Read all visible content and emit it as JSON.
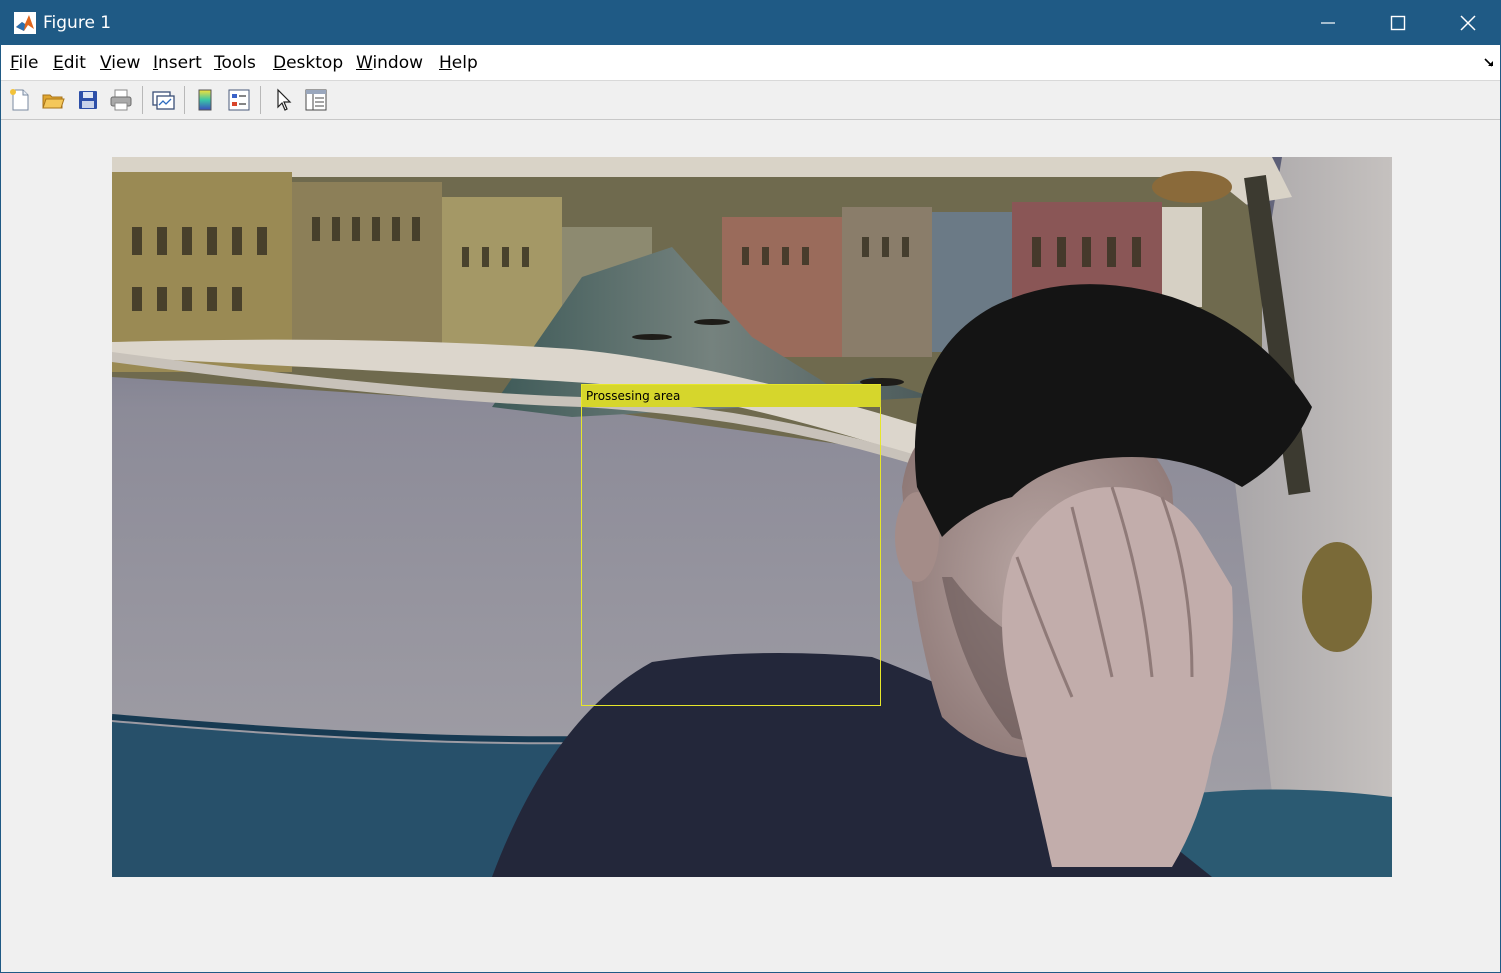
{
  "window": {
    "title": "Figure 1",
    "controls": {
      "minimize_icon": "minimize-icon",
      "maximize_icon": "maximize-icon",
      "close_icon": "close-icon"
    },
    "titlebar_color": "#1f5a85"
  },
  "menubar": {
    "items": [
      {
        "label": "File",
        "mnemonic": "F",
        "rest": "ile"
      },
      {
        "label": "Edit",
        "mnemonic": "E",
        "rest": "dit"
      },
      {
        "label": "View",
        "mnemonic": "V",
        "rest": "iew"
      },
      {
        "label": "Insert",
        "mnemonic": "I",
        "rest": "nsert"
      },
      {
        "label": "Tools",
        "mnemonic": "T",
        "rest": "ools"
      },
      {
        "label": "Desktop",
        "mnemonic": "D",
        "rest": "esktop"
      },
      {
        "label": "Window",
        "mnemonic": "W",
        "rest": "indow"
      },
      {
        "label": "Help",
        "mnemonic": "H",
        "rest": "elp"
      }
    ]
  },
  "toolbar": {
    "buttons": [
      "new-figure-icon",
      "open-file-icon",
      "save-figure-icon",
      "print-figure-icon",
      "link-plot-icon",
      "insert-colorbar-icon",
      "insert-legend-icon",
      "edit-plot-icon",
      "property-inspector-icon"
    ]
  },
  "figure": {
    "roi_label": "Prossesing area",
    "roi_color": "#e6e62a",
    "roi_label_color": "#d6d62c"
  }
}
